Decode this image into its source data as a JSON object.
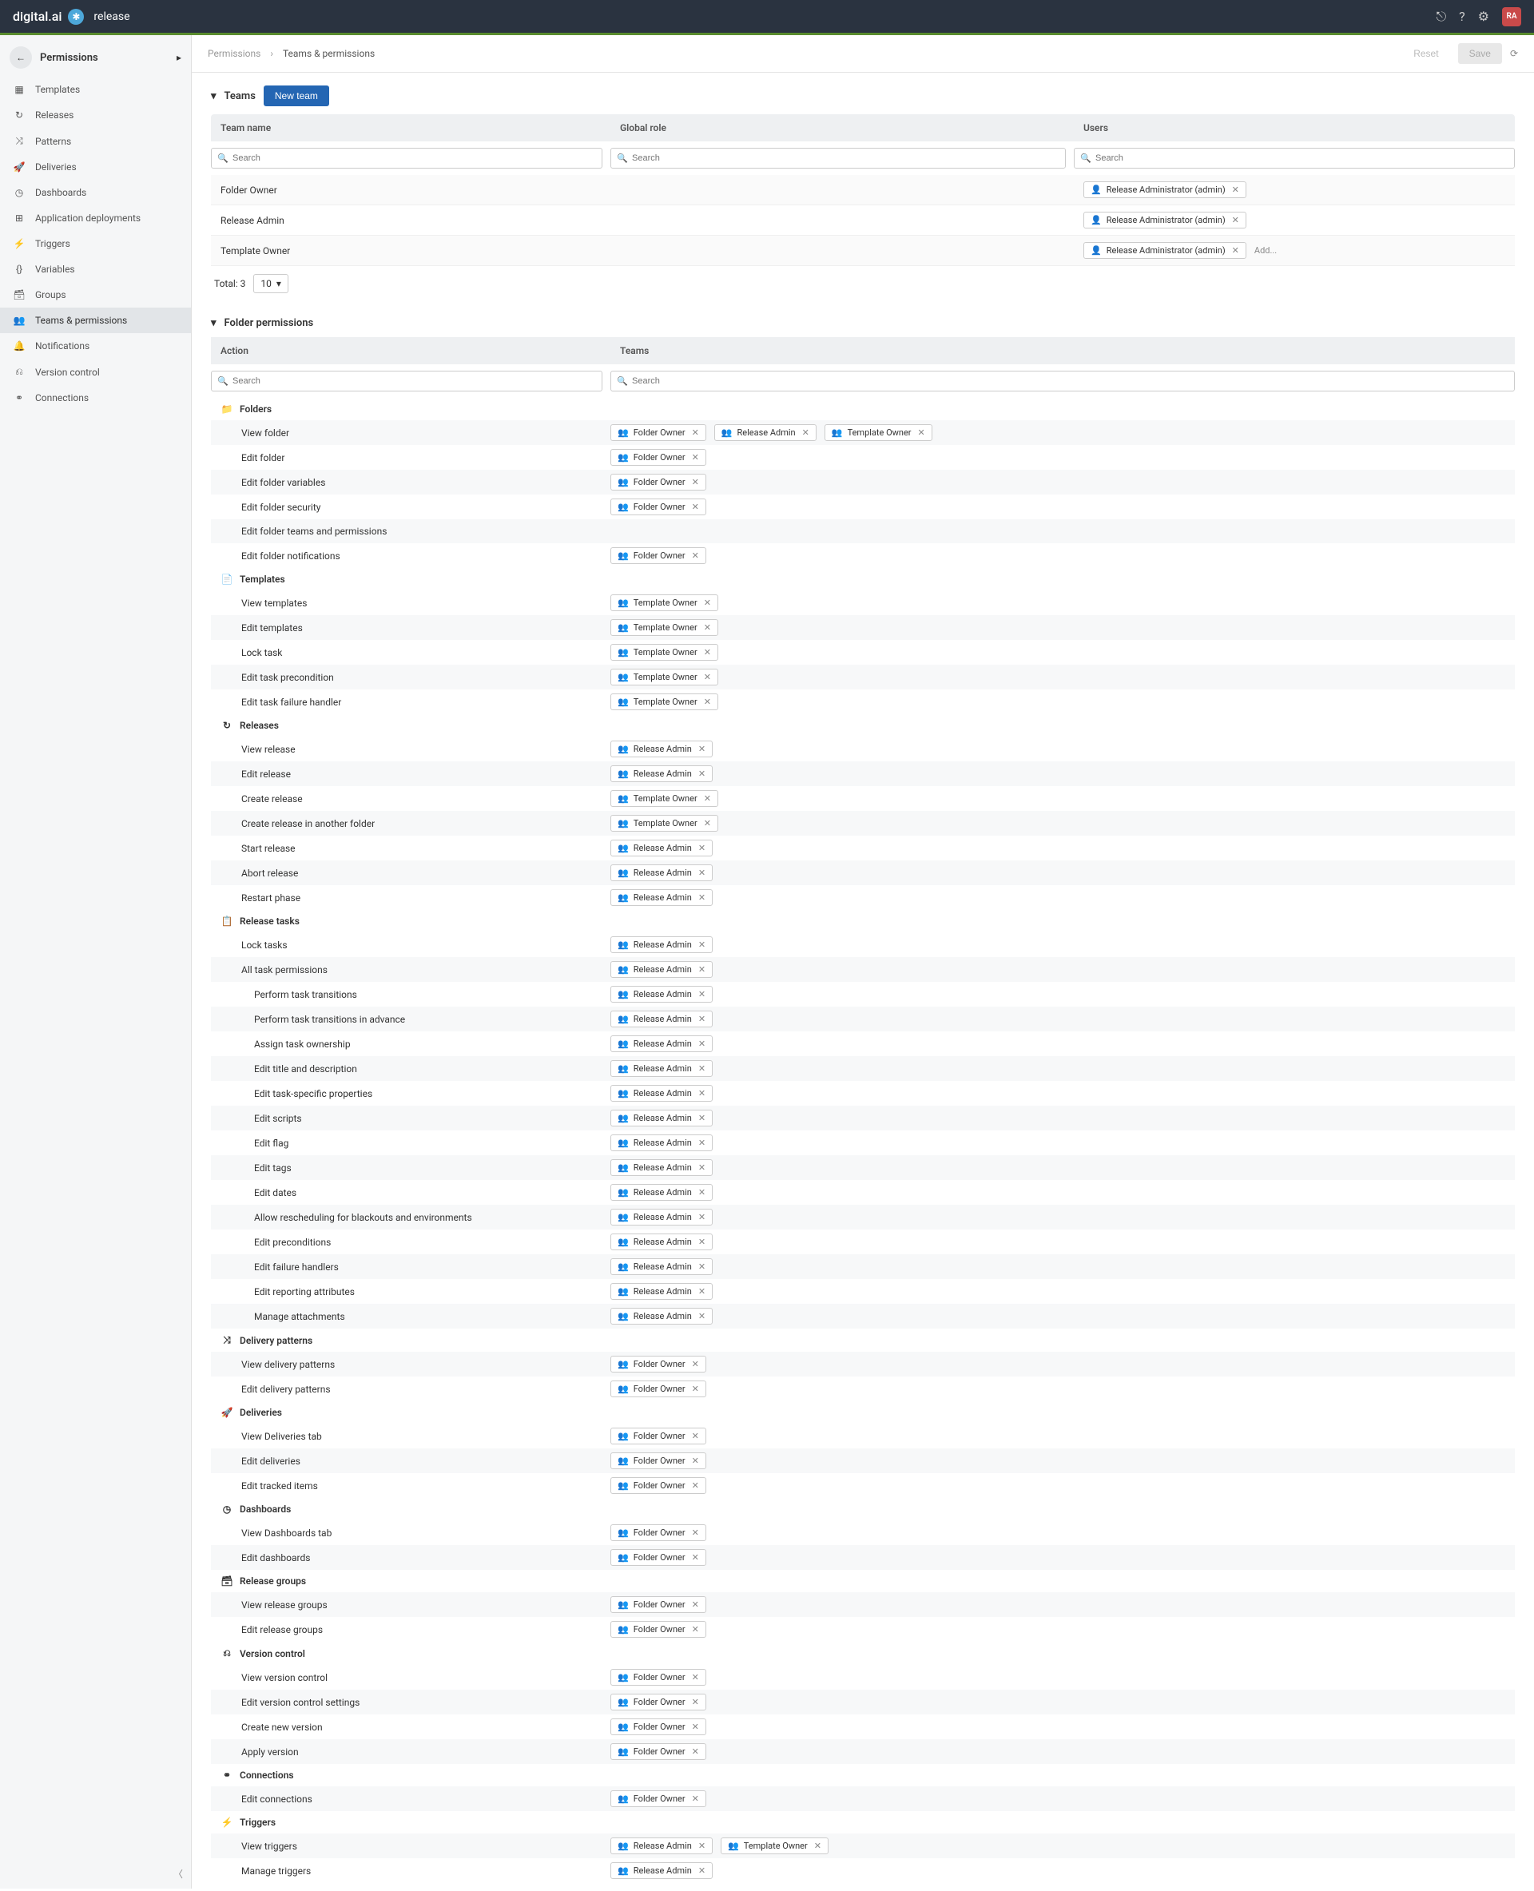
{
  "header": {
    "brand": "digital.ai",
    "product": "release",
    "avatar": "RA"
  },
  "sidebar": {
    "title": "Permissions",
    "items": [
      {
        "label": "Templates"
      },
      {
        "label": "Releases"
      },
      {
        "label": "Patterns"
      },
      {
        "label": "Deliveries"
      },
      {
        "label": "Dashboards"
      },
      {
        "label": "Application deployments"
      },
      {
        "label": "Triggers"
      },
      {
        "label": "Variables"
      },
      {
        "label": "Groups"
      },
      {
        "label": "Teams & permissions"
      },
      {
        "label": "Notifications"
      },
      {
        "label": "Version control"
      },
      {
        "label": "Connections"
      }
    ]
  },
  "breadcrumb": {
    "root": "Permissions",
    "current": "Teams & permissions"
  },
  "actions": {
    "reset": "Reset",
    "save": "Save"
  },
  "teams": {
    "title": "Teams",
    "newTeam": "New team",
    "cols": {
      "name": "Team name",
      "role": "Global role",
      "users": "Users"
    },
    "searchPh": "Search",
    "rows": [
      {
        "name": "Folder Owner",
        "user": "Release Administrator (admin)"
      },
      {
        "name": "Release Admin",
        "user": "Release Administrator (admin)"
      },
      {
        "name": "Template Owner",
        "user": "Release Administrator (admin)"
      }
    ],
    "addLabel": "Add...",
    "total": "Total: 3",
    "pageSize": "10"
  },
  "folderPerms": {
    "title": "Folder permissions",
    "cols": {
      "action": "Action",
      "teams": "Teams"
    },
    "searchPh": "Search",
    "groups": [
      {
        "name": "Folders",
        "actions": [
          {
            "label": "View folder",
            "teams": [
              "Folder Owner",
              "Release Admin",
              "Template Owner"
            ]
          },
          {
            "label": "Edit folder",
            "teams": [
              "Folder Owner"
            ]
          },
          {
            "label": "Edit folder variables",
            "teams": [
              "Folder Owner"
            ]
          },
          {
            "label": "Edit folder security",
            "teams": [
              "Folder Owner"
            ]
          },
          {
            "label": "Edit folder teams and permissions",
            "teams": []
          },
          {
            "label": "Edit folder notifications",
            "teams": [
              "Folder Owner"
            ]
          }
        ]
      },
      {
        "name": "Templates",
        "actions": [
          {
            "label": "View templates",
            "teams": [
              "Template Owner"
            ]
          },
          {
            "label": "Edit templates",
            "teams": [
              "Template Owner"
            ]
          },
          {
            "label": "Lock task",
            "teams": [
              "Template Owner"
            ]
          },
          {
            "label": "Edit task precondition",
            "teams": [
              "Template Owner"
            ]
          },
          {
            "label": "Edit task failure handler",
            "teams": [
              "Template Owner"
            ]
          }
        ]
      },
      {
        "name": "Releases",
        "actions": [
          {
            "label": "View release",
            "teams": [
              "Release Admin"
            ]
          },
          {
            "label": "Edit release",
            "teams": [
              "Release Admin"
            ]
          },
          {
            "label": "Create release",
            "teams": [
              "Template Owner"
            ]
          },
          {
            "label": "Create release in another folder",
            "teams": [
              "Template Owner"
            ]
          },
          {
            "label": "Start release",
            "teams": [
              "Release Admin"
            ]
          },
          {
            "label": "Abort release",
            "teams": [
              "Release Admin"
            ]
          },
          {
            "label": "Restart phase",
            "teams": [
              "Release Admin"
            ]
          }
        ]
      },
      {
        "name": "Release tasks",
        "actions": [
          {
            "label": "Lock tasks",
            "teams": [
              "Release Admin"
            ]
          },
          {
            "label": "All task permissions",
            "teams": [
              "Release Admin"
            ]
          },
          {
            "label": "Perform task transitions",
            "indent": true,
            "teams": [
              "Release Admin"
            ]
          },
          {
            "label": "Perform task transitions in advance",
            "indent": true,
            "teams": [
              "Release Admin"
            ]
          },
          {
            "label": "Assign task ownership",
            "indent": true,
            "teams": [
              "Release Admin"
            ]
          },
          {
            "label": "Edit title and description",
            "indent": true,
            "teams": [
              "Release Admin"
            ]
          },
          {
            "label": "Edit task-specific properties",
            "indent": true,
            "teams": [
              "Release Admin"
            ]
          },
          {
            "label": "Edit scripts",
            "indent": true,
            "teams": [
              "Release Admin"
            ]
          },
          {
            "label": "Edit flag",
            "indent": true,
            "teams": [
              "Release Admin"
            ]
          },
          {
            "label": "Edit tags",
            "indent": true,
            "teams": [
              "Release Admin"
            ]
          },
          {
            "label": "Edit dates",
            "indent": true,
            "teams": [
              "Release Admin"
            ]
          },
          {
            "label": "Allow rescheduling for blackouts and environments",
            "indent": true,
            "teams": [
              "Release Admin"
            ]
          },
          {
            "label": "Edit preconditions",
            "indent": true,
            "teams": [
              "Release Admin"
            ]
          },
          {
            "label": "Edit failure handlers",
            "indent": true,
            "teams": [
              "Release Admin"
            ]
          },
          {
            "label": "Edit reporting attributes",
            "indent": true,
            "teams": [
              "Release Admin"
            ]
          },
          {
            "label": "Manage attachments",
            "indent": true,
            "teams": [
              "Release Admin"
            ]
          }
        ]
      },
      {
        "name": "Delivery patterns",
        "actions": [
          {
            "label": "View delivery patterns",
            "teams": [
              "Folder Owner"
            ]
          },
          {
            "label": "Edit delivery patterns",
            "teams": [
              "Folder Owner"
            ]
          }
        ]
      },
      {
        "name": "Deliveries",
        "actions": [
          {
            "label": "View Deliveries tab",
            "teams": [
              "Folder Owner"
            ]
          },
          {
            "label": "Edit deliveries",
            "teams": [
              "Folder Owner"
            ]
          },
          {
            "label": "Edit tracked items",
            "teams": [
              "Folder Owner"
            ]
          }
        ]
      },
      {
        "name": "Dashboards",
        "actions": [
          {
            "label": "View Dashboards tab",
            "teams": [
              "Folder Owner"
            ]
          },
          {
            "label": "Edit dashboards",
            "teams": [
              "Folder Owner"
            ]
          }
        ]
      },
      {
        "name": "Release groups",
        "actions": [
          {
            "label": "View release groups",
            "teams": [
              "Folder Owner"
            ]
          },
          {
            "label": "Edit release groups",
            "teams": [
              "Folder Owner"
            ]
          }
        ]
      },
      {
        "name": "Version control",
        "actions": [
          {
            "label": "View version control",
            "teams": [
              "Folder Owner"
            ]
          },
          {
            "label": "Edit version control settings",
            "teams": [
              "Folder Owner"
            ]
          },
          {
            "label": "Create new version",
            "teams": [
              "Folder Owner"
            ]
          },
          {
            "label": "Apply version",
            "teams": [
              "Folder Owner"
            ]
          }
        ]
      },
      {
        "name": "Connections",
        "actions": [
          {
            "label": "Edit connections",
            "teams": [
              "Folder Owner"
            ]
          }
        ]
      },
      {
        "name": "Triggers",
        "actions": [
          {
            "label": "View triggers",
            "teams": [
              "Release Admin",
              "Template Owner"
            ]
          },
          {
            "label": "Manage triggers",
            "teams": [
              "Release Admin"
            ]
          }
        ]
      }
    ]
  }
}
